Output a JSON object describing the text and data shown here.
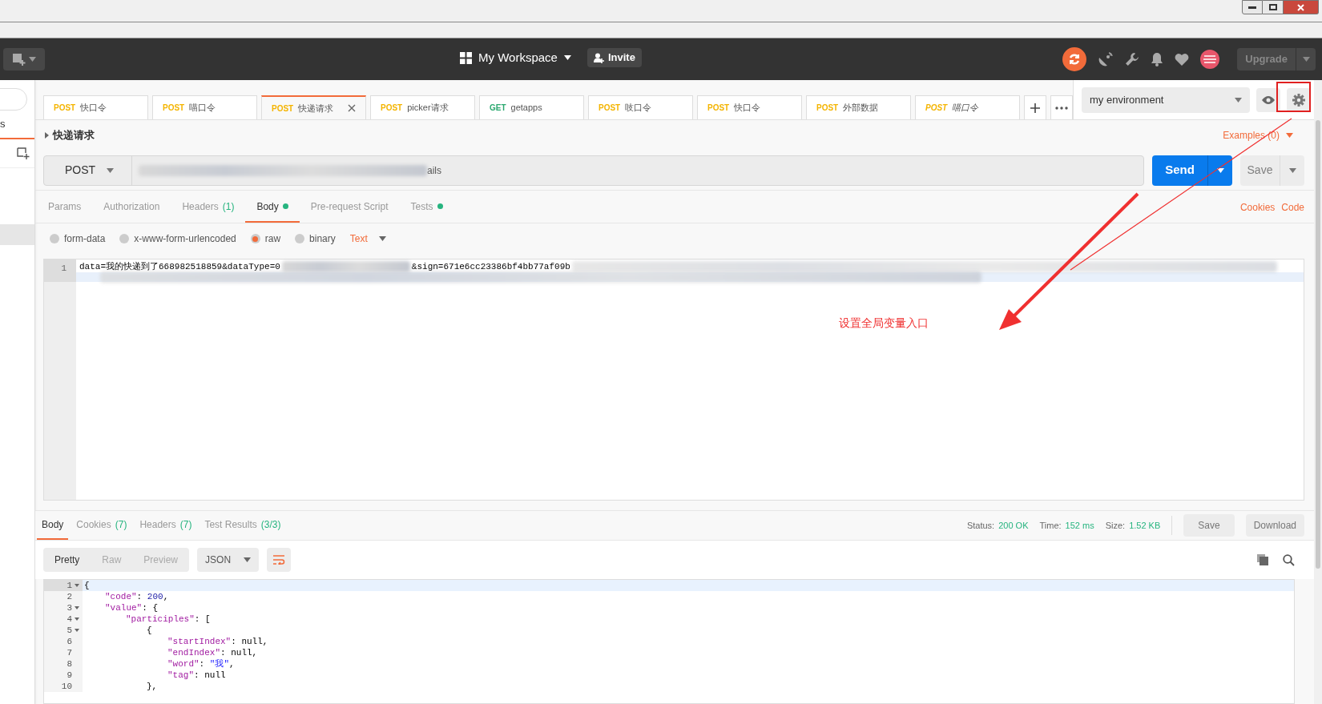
{
  "header": {
    "workspace": "My Workspace",
    "invite": "Invite",
    "upgrade": "Upgrade"
  },
  "sidebar": {
    "tab_fragment": "s"
  },
  "tabs": [
    {
      "method": "POST",
      "name": "快口令",
      "selected": false,
      "preview": false
    },
    {
      "method": "POST",
      "name": "喵口令",
      "selected": false,
      "preview": false
    },
    {
      "method": "POST",
      "name": "快递请求",
      "selected": true,
      "preview": false
    },
    {
      "method": "POST",
      "name": "picker请求",
      "selected": false,
      "preview": false
    },
    {
      "method": "GET",
      "name": "getapps",
      "selected": false,
      "preview": false
    },
    {
      "method": "POST",
      "name": "吱口令",
      "selected": false,
      "preview": false
    },
    {
      "method": "POST",
      "name": "快口令",
      "selected": false,
      "preview": false
    },
    {
      "method": "POST",
      "name": "外部数据",
      "selected": false,
      "preview": false
    },
    {
      "method": "POST",
      "name": "喵口令",
      "selected": false,
      "preview": true
    }
  ],
  "environment": {
    "value": "my environment"
  },
  "request": {
    "name": "快递请求",
    "examples": "Examples (0)",
    "method": "POST",
    "url_visible": "ails",
    "send": "Send",
    "save": "Save"
  },
  "request_tabs": [
    {
      "label": "Params",
      "selected": false,
      "dot": false
    },
    {
      "label": "Authorization",
      "selected": false,
      "dot": false
    },
    {
      "label": "Headers",
      "count": "(1)",
      "selected": false,
      "dot": false
    },
    {
      "label": "Body",
      "selected": true,
      "dot": true
    },
    {
      "label": "Pre-request Script",
      "selected": false,
      "dot": false
    },
    {
      "label": "Tests",
      "selected": false,
      "dot": true
    }
  ],
  "links": [
    "Cookies",
    "Code"
  ],
  "body_modes": [
    {
      "label": "form-data",
      "selected": false
    },
    {
      "label": "x-www-form-urlencoded",
      "selected": false
    },
    {
      "label": "raw",
      "selected": true
    },
    {
      "label": "binary",
      "selected": false
    }
  ],
  "body_format": "Text",
  "editor": {
    "line_number": "1",
    "text_start": "data=我的快递到了668982518859&dataType=0",
    "text_after": "&sign=671e6cc23386bf4bb77af09b"
  },
  "annotation": {
    "text": "设置全局变量入口"
  },
  "response": {
    "tabs": [
      {
        "label": "Body",
        "selected": true
      },
      {
        "label": "Cookies",
        "count": "(7)",
        "selected": false
      },
      {
        "label": "Headers",
        "count": "(7)",
        "selected": false
      },
      {
        "label": "Test Results",
        "count": "(3/3)",
        "selected": false
      }
    ],
    "stats": [
      {
        "label": "Status:",
        "value": "200 OK"
      },
      {
        "label": "Time:",
        "value": "152 ms"
      },
      {
        "label": "Size:",
        "value": "1.52 KB"
      }
    ],
    "save": "Save",
    "download": "Download",
    "views": [
      {
        "label": "Pretty",
        "selected": true
      },
      {
        "label": "Raw",
        "selected": false
      },
      {
        "label": "Preview",
        "selected": false
      }
    ],
    "format": "JSON",
    "lines": [
      {
        "num": "1",
        "fold": true,
        "tokens": [
          {
            "kind": "punct",
            "text": "{"
          }
        ]
      },
      {
        "num": "2",
        "fold": false,
        "tokens": [
          {
            "kind": "key",
            "text": "\"code\""
          },
          {
            "kind": "punct",
            "text": ": "
          },
          {
            "kind": "number",
            "text": "200"
          },
          {
            "kind": "punct",
            "text": ","
          }
        ]
      },
      {
        "num": "3",
        "fold": true,
        "tokens": [
          {
            "kind": "key",
            "text": "\"value\""
          },
          {
            "kind": "punct",
            "text": ": {"
          }
        ]
      },
      {
        "num": "4",
        "fold": true,
        "tokens": [
          {
            "kind": "key",
            "text": "\"participles\""
          },
          {
            "kind": "punct",
            "text": ": ["
          }
        ]
      },
      {
        "num": "5",
        "fold": true,
        "tokens": [
          {
            "kind": "punct",
            "text": "{"
          }
        ]
      },
      {
        "num": "6",
        "fold": false,
        "tokens": [
          {
            "kind": "key",
            "text": "\"startIndex\""
          },
          {
            "kind": "punct",
            "text": ": null,"
          }
        ]
      },
      {
        "num": "7",
        "fold": false,
        "tokens": [
          {
            "kind": "key",
            "text": "\"endIndex\""
          },
          {
            "kind": "punct",
            "text": ": null,"
          }
        ]
      },
      {
        "num": "8",
        "fold": false,
        "tokens": [
          {
            "kind": "key",
            "text": "\"word\""
          },
          {
            "kind": "punct",
            "text": ": "
          },
          {
            "kind": "string",
            "text": "\"我\""
          },
          {
            "kind": "punct",
            "text": ","
          }
        ]
      },
      {
        "num": "9",
        "fold": false,
        "tokens": [
          {
            "kind": "key",
            "text": "\"tag\""
          },
          {
            "kind": "punct",
            "text": ": null"
          }
        ]
      },
      {
        "num": "10",
        "fold": false,
        "tokens": [
          {
            "kind": "punct",
            "text": "},"
          }
        ]
      }
    ]
  }
}
